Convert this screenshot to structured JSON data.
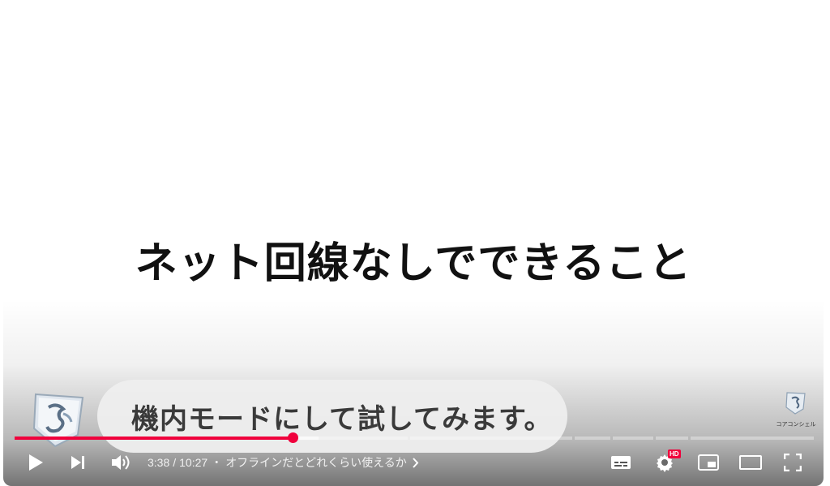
{
  "video": {
    "slide_title": "ネット回線なしでできること",
    "caption": "機内モードにして試してみます。",
    "brand_logo_text": "コアコンシェル"
  },
  "player": {
    "current_time": "3:38",
    "time_separator": "/",
    "duration": "10:27",
    "chapter_separator": "・",
    "chapter_title": "オフラインだとどれくらい使えるか",
    "played_fraction": 0.348,
    "buffered_fraction": 0.38,
    "hd_badge": "HD",
    "accent_color": "#f0003c"
  },
  "icons": {
    "play": "play-icon",
    "next": "next-icon",
    "volume": "volume-icon",
    "chapter_chevron": "chevron-right-icon",
    "subtitles": "subtitles-icon",
    "settings": "gear-icon",
    "miniplayer": "miniplayer-icon",
    "theater": "theater-mode-icon",
    "fullscreen": "fullscreen-icon"
  }
}
